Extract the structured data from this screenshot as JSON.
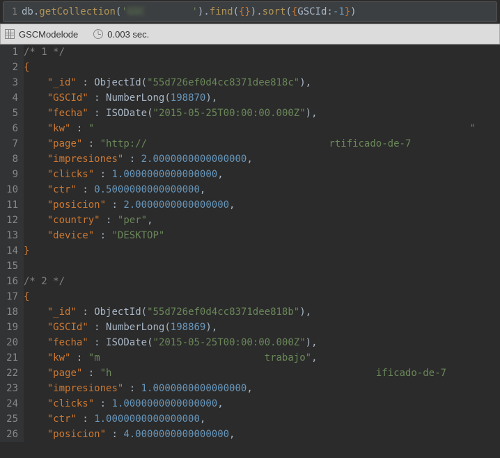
{
  "query": {
    "lineNo": "1",
    "t_db": "db",
    "t_dot1": ".",
    "t_getCollection": "getCollection",
    "t_paren1": "(",
    "t_collQ1": "'",
    "t_collName": "GSC        ",
    "t_collQ2": "'",
    "t_paren2": ")",
    "t_dot2": ".",
    "t_find": "find",
    "t_findOpen": "(",
    "t_findBraces": "{}",
    "t_findClose": ")",
    "t_dot3": ".",
    "t_sort": "sort",
    "t_sortOpen": "(",
    "t_sortBrOpen": "{",
    "t_sortKey": "GSCId",
    "t_sortColon": ":",
    "t_sortVal": "-1",
    "t_sortBrClose": "}",
    "t_sortClose": ")"
  },
  "status": {
    "collection": "GSCModelode",
    "time": "0.003 sec."
  },
  "code": {
    "q": "\"",
    "comma": ",",
    "colon": ":",
    "colonSp": " : ",
    "openBr": "{",
    "closeBr": "}",
    "openP": "(",
    "closeP": ")",
    "line1": "/* 1 */",
    "line16": "/* 2 */",
    "k_id": "_id",
    "k_gscid": "GSCId",
    "k_fecha": "fecha",
    "k_kw": "kw",
    "k_page": "page",
    "k_impresiones": "impresiones",
    "k_clicks": "clicks",
    "k_ctr": "ctr",
    "k_posicion": "posicion",
    "k_country": "country",
    "k_device": "device",
    "t_ObjectId": "ObjectId",
    "t_NumberLong": "NumberLong",
    "t_ISODate": "ISODate",
    "d1_id": "55d726ef0d4cc8371dee818c",
    "d1_gscid": "198870",
    "d1_fecha": "2015-05-25T00:00:00.000Z",
    "d1_kw": "                                                                ",
    "d1_page_pre": "http://",
    "d1_page_mid": "                               ",
    "d1_page_suf": "rtificado-de-7",
    "d1_impresiones": "2.0000000000000000",
    "d1_clicks": "1.0000000000000000",
    "d1_ctr": "0.5000000000000000",
    "d1_posicion": "2.0000000000000000",
    "d1_country": "per",
    "d1_device": "DESKTOP",
    "d2_id": "55d726ef0d4cc8371dee818b",
    "d2_gscid": "198869",
    "d2_fecha": "2015-05-25T00:00:00.000Z",
    "d2_kw_pre": "m",
    "d2_kw_mid": "                            ",
    "d2_kw_suf": "trabajo",
    "d2_page_pre": "h",
    "d2_page_mid": "                                             ",
    "d2_page_suf": "ificado-de-7",
    "d2_impresiones": "1.0000000000000000",
    "d2_clicks": "1.0000000000000000",
    "d2_ctr": "1.0000000000000000",
    "d2_posicion": "4.0000000000000000"
  },
  "gutter": [
    "1",
    "2",
    "3",
    "4",
    "5",
    "6",
    "7",
    "8",
    "9",
    "10",
    "11",
    "12",
    "13",
    "14",
    "15",
    "16",
    "17",
    "18",
    "19",
    "20",
    "21",
    "22",
    "23",
    "24",
    "25",
    "26"
  ]
}
